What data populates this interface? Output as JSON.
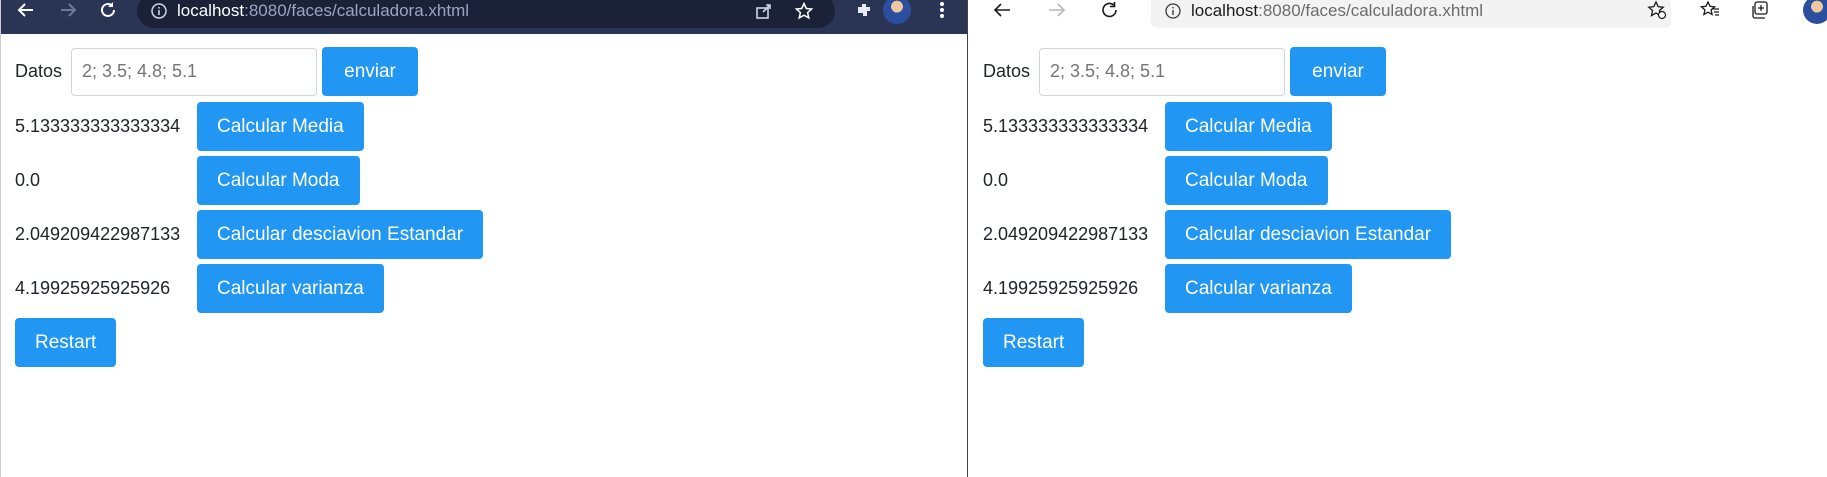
{
  "browsers": [
    {
      "url_host": "localhost",
      "url_rest": ":8080/faces/calculadora.xhtml",
      "form": {
        "datos_label": "Datos",
        "datos_placeholder": "2; 3.5; 4.8; 5.1",
        "send_label": "enviar",
        "rows": [
          {
            "result": "5.133333333333334",
            "button": "Calcular Media"
          },
          {
            "result": "0.0",
            "button": "Calcular Moda"
          },
          {
            "result": "2.049209422987133",
            "button": "Calcular desciavion Estandar"
          },
          {
            "result": "4.19925925925926",
            "button": "Calcular varianza"
          }
        ],
        "restart_label": "Restart"
      }
    },
    {
      "url_host": "localhost",
      "url_rest": ":8080/faces/calculadora.xhtml",
      "form": {
        "datos_label": "Datos",
        "datos_placeholder": "2; 3.5; 4.8; 5.1",
        "send_label": "enviar",
        "rows": [
          {
            "result": "5.133333333333334",
            "button": "Calcular Media"
          },
          {
            "result": "0.0",
            "button": "Calcular Moda"
          },
          {
            "result": "2.049209422987133",
            "button": "Calcular desciavion Estandar"
          },
          {
            "result": "4.19925925925926",
            "button": "Calcular varianza"
          }
        ],
        "restart_label": "Restart"
      }
    }
  ],
  "colors": {
    "button_bg": "#2196f3",
    "chrome_toolbar": "#2a3555",
    "edge_toolbar": "#ffffff"
  },
  "icons": [
    "back-arrow-icon",
    "forward-arrow-icon",
    "reload-icon",
    "info-icon",
    "share-icon",
    "star-icon",
    "extensions-icon",
    "avatar",
    "menu-icon",
    "favorites-add-icon",
    "favorites-icon",
    "collections-icon"
  ]
}
